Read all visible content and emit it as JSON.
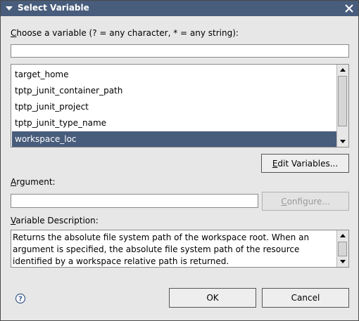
{
  "window": {
    "title": "Select Variable"
  },
  "filter": {
    "label_mnemonic": "C",
    "label_rest": "hoose a variable (? = any character, * = any string):",
    "value": ""
  },
  "variables": [
    {
      "name": "target_home",
      "selected": false
    },
    {
      "name": "tptp_junit_container_path",
      "selected": false
    },
    {
      "name": "tptp_junit_project",
      "selected": false
    },
    {
      "name": "tptp_junit_type_name",
      "selected": false
    },
    {
      "name": "workspace_loc",
      "selected": true
    }
  ],
  "edit_variables": {
    "mnemonic": "E",
    "rest": "dit Variables..."
  },
  "argument": {
    "label_mnemonic": "A",
    "label_rest": "rgument:",
    "value": ""
  },
  "configure": {
    "mnemonic": "C",
    "rest": "onfigure..."
  },
  "description": {
    "label_mnemonic": "V",
    "label_rest": "ariable Description:",
    "text": "Returns the absolute file system path of the workspace root. When an argument is specified, the absolute file system path of the resource identified by a workspace relative path is returned."
  },
  "ok_label": "OK",
  "cancel_label": "Cancel",
  "icons": {
    "menu": "triangle-down-icon",
    "close": "close-icon",
    "help": "help-icon"
  },
  "colors": {
    "titlebar": "#485c7c",
    "selection": "#485c7c",
    "dialog_bg": "#e7e7e7"
  }
}
